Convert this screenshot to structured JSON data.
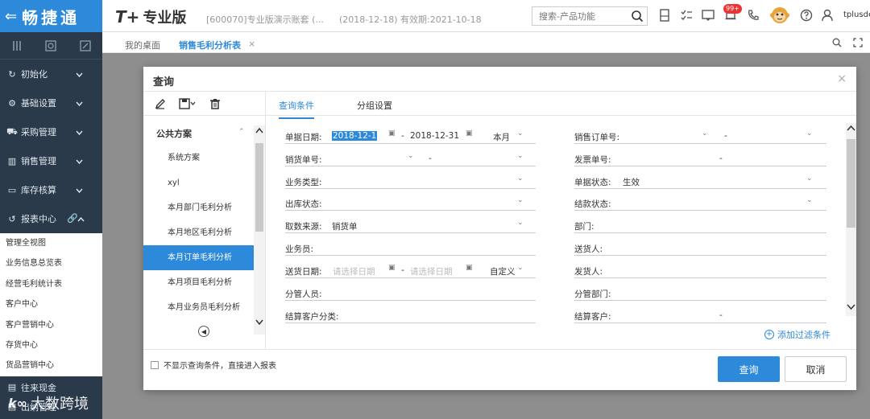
{
  "header": {
    "brand": "畅捷通",
    "product_prefix": "T+",
    "product_name": "专业版",
    "account": "[600070]专业版演示账套 (...",
    "period": "(2018-12-18)  有效期:2021-10-18",
    "search_placeholder": "搜索-产品功能",
    "badge": "99+",
    "user": "tplusdemo"
  },
  "sidebar": {
    "items": [
      {
        "label": "初始化",
        "icon": "refresh-icon"
      },
      {
        "label": "基础设置",
        "icon": "settings-icon"
      },
      {
        "label": "采购管理",
        "icon": "cart-icon"
      },
      {
        "label": "销售管理",
        "icon": "chart-icon"
      },
      {
        "label": "库存核算",
        "icon": "box-icon"
      }
    ],
    "report": "报表中心",
    "submenu": [
      "管理全视图",
      "业务信息总览表",
      "经营毛利统计表",
      "客户中心",
      "客户营销中心",
      "存货中心",
      "货品营销中心"
    ],
    "bottom": [
      "往来现金",
      "出纳管理"
    ],
    "watermark": "大数跨境"
  },
  "tabs": {
    "home": "我的桌面",
    "active": "销售毛利分析表"
  },
  "dialog": {
    "title": "查询",
    "tabs": [
      "查询条件",
      "分组设置"
    ],
    "scheme_header": "公共方案",
    "schemes": [
      "系统方案",
      "xyl",
      "本月部门毛利分析",
      "本月地区毛利分析",
      "本月订单毛利分析",
      "本月项目毛利分析",
      "本月业务员毛利分析"
    ],
    "selected_scheme_index": 4,
    "left_fields": {
      "doc_date": {
        "label": "单据日期:",
        "from": "2018-12-1",
        "to": "2018-12-31",
        "preset": "本月"
      },
      "sale_no": {
        "label": "销货单号:",
        "dash": "-"
      },
      "biz_type": {
        "label": "业务类型:"
      },
      "out_status": {
        "label": "出库状态:"
      },
      "source": {
        "label": "取数来源:",
        "value": "销货单"
      },
      "salesman": {
        "label": "业务员:"
      },
      "delivery_date": {
        "label": "送货日期:",
        "from_ph": "请选择日期",
        "to_ph": "请选择日期",
        "preset": "自定义"
      },
      "manager": {
        "label": "分管人员:"
      },
      "cust_class": {
        "label": "结算客户分类:"
      }
    },
    "right_fields": {
      "order_no": {
        "label": "销售订单号:",
        "dash": "-"
      },
      "invoice_no": {
        "label": "发票单号:",
        "dash": "-"
      },
      "doc_status": {
        "label": "单据状态:",
        "value": "生效"
      },
      "settle_status": {
        "label": "结款状态:"
      },
      "dept": {
        "label": "部门:"
      },
      "deliverer": {
        "label": "送货人:"
      },
      "shipper": {
        "label": "发货人:"
      },
      "mgr_dept": {
        "label": "分管部门:"
      },
      "settle_cust": {
        "label": "结算客户:",
        "dash": "-"
      }
    },
    "add_filter": "添加过滤条件",
    "skip_label": "不显示查询条件，直接进入报表",
    "query_btn": "查询",
    "cancel_btn": "取消"
  }
}
